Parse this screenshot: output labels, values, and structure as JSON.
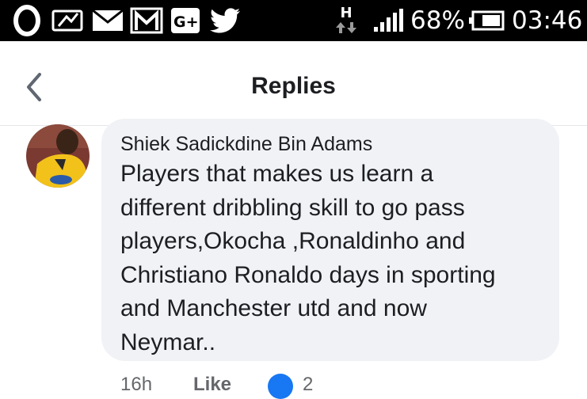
{
  "status_bar": {
    "left_icons": [
      "opera-icon",
      "chat-bubble-icon",
      "mail-icon",
      "gmail-icon",
      "google-plus-icon",
      "twitter-icon"
    ],
    "network_type": "H",
    "battery_percent": "68%",
    "time": "03:46"
  },
  "header": {
    "back_icon": "chevron-left-icon",
    "title": "Replies"
  },
  "comment": {
    "author": "Shiek Sadickdine Bin Adams",
    "lines": [
      "Players that makes us learn a",
      "different dribbling skill to go pass",
      "players,Okocha ,Ronaldinho and",
      "Christiano Ronaldo days in sporting",
      "and Manchester utd and now",
      "Neymar.."
    ],
    "time_ago": "16h",
    "like_label": "Like",
    "like_count": "2"
  },
  "colors": {
    "status_bar_bg": "#000000",
    "bubble_bg": "#f0f2f5",
    "text": "#1c1e21",
    "secondary_text": "#65676b",
    "like_blue": "#1877f2"
  }
}
